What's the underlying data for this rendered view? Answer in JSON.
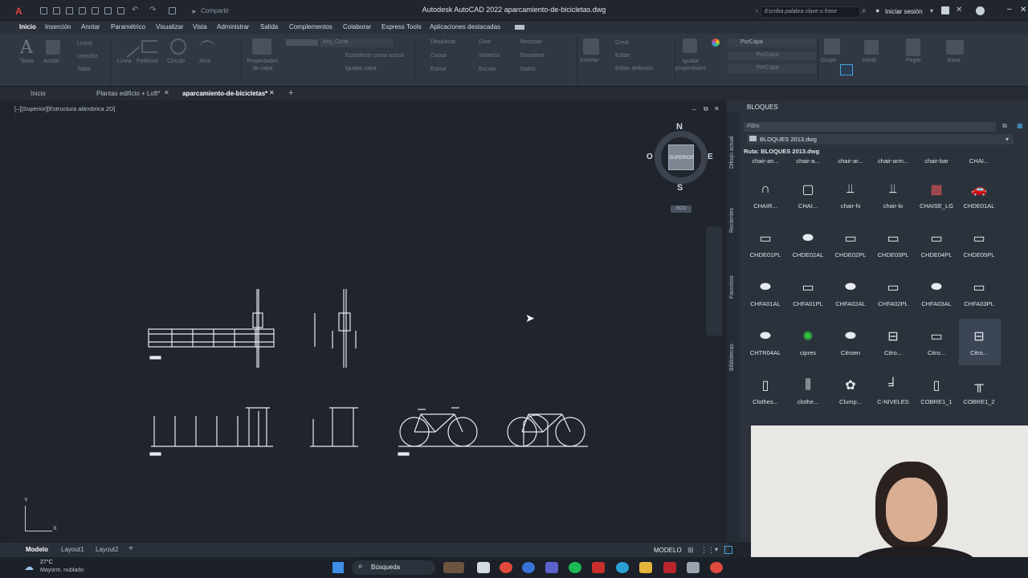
{
  "titlebar": {
    "title": "Autodesk AutoCAD 2022   aparcamiento-de-bicicletas.dwg",
    "share": "Compartir",
    "search_placeholder": "Escriba palabra clave o frase",
    "signin": "Iniciar sesión"
  },
  "menu": [
    "Inicio",
    "Inserción",
    "Anotar",
    "Paramétrico",
    "Visualizar",
    "Vista",
    "Administrar",
    "Salida",
    "Complementos",
    "Colaborar",
    "Express Tools",
    "Aplicaciones destacadas"
  ],
  "ribbon": {
    "draw": [
      "Línea",
      "Polilínea",
      "Círculo",
      "Arco"
    ],
    "modify": [
      "Desplazar",
      "Girar",
      "Recortar",
      "Copiar",
      "Simetría",
      "Empalme",
      "Estirar",
      "Escala",
      "Matriz"
    ],
    "layers": {
      "props": "Propiedades de capa",
      "layer_name": "Arq_Corte",
      "make_current": "Establecer como actual",
      "match": "Igualar capa"
    },
    "annot": {
      "text": "Texto",
      "dim": "Acotar",
      "lineal": "Lineal",
      "directriz": "Directriz",
      "tabla": "Tabla"
    },
    "block": {
      "insert": "Insertar",
      "create": "Crear",
      "edit": "Editar",
      "attrs": "Editar atributos"
    },
    "props": {
      "match": "Igualar propiedades",
      "bylayer": "PorCapa"
    },
    "others": {
      "group": "Grupo",
      "measure": "Medir",
      "paste": "Pegar",
      "base": "Base"
    }
  },
  "doctabs": [
    "Inicio",
    "Plantas edificio + Loft*",
    "aparcamiento-de-bicicletas*"
  ],
  "viewport": {
    "info": "[–][Superior][Estructura alámbrica 2D]",
    "compass": {
      "n": "N",
      "s": "S",
      "e": "E",
      "w": "O",
      "face": "SUPERIOR",
      "wcs": "SCU"
    },
    "ucs_y": "Y",
    "ucs_x": "X"
  },
  "layouts": [
    "Modelo",
    "Layout1",
    "Layout2"
  ],
  "status": {
    "model": "MODELO"
  },
  "palette": {
    "title": "BLOQUES",
    "filter": "Filtro",
    "file": "BLOQUES 2013.dwg",
    "path": "Ruta: BLOQUES 2013.dwg",
    "side_tabs": [
      "Dibujo actual",
      "Recientes",
      "Favoritos",
      "Bibliotecas"
    ],
    "header_row": [
      "chair-an...",
      "chair-a...",
      "chair-ar...",
      "chair-arm...",
      "chair-bar",
      "CHAI..."
    ],
    "rows": [
      [
        {
          "n": "CHAIR...",
          "i": "∩"
        },
        {
          "n": "CHAI...",
          "i": "▢"
        },
        {
          "n": "chair-hi",
          "i": "⫫"
        },
        {
          "n": "chair-lo",
          "i": "⫫"
        },
        {
          "n": "CHAISE_LG",
          "i": "▦"
        },
        {
          "n": "CHDE01AL",
          "i": "🚗"
        }
      ],
      [
        {
          "n": "CHDE01PL",
          "i": "▭"
        },
        {
          "n": "CHDE02AL",
          "i": "⬬"
        },
        {
          "n": "CHDE02PL",
          "i": "▭"
        },
        {
          "n": "CHDE03PL",
          "i": "▭"
        },
        {
          "n": "CHDE04PL",
          "i": "▭"
        },
        {
          "n": "CHDE05PL",
          "i": "▭"
        }
      ],
      [
        {
          "n": "CHFA01AL",
          "i": "⬬"
        },
        {
          "n": "CHFA01PL",
          "i": "▭"
        },
        {
          "n": "CHFA02AL",
          "i": "⬬"
        },
        {
          "n": "CHFA02PL",
          "i": "▭"
        },
        {
          "n": "CHFA03AL",
          "i": "⬬"
        },
        {
          "n": "CHFA03PL",
          "i": "▭"
        }
      ],
      [
        {
          "n": "CHTR04AL",
          "i": "⬬"
        },
        {
          "n": "cipres",
          "i": "✺"
        },
        {
          "n": "Citroen",
          "i": "⬬"
        },
        {
          "n": "Citro...",
          "i": "⊟"
        },
        {
          "n": "Citro...",
          "i": "▭"
        },
        {
          "n": "Citro...",
          "i": "⊟"
        }
      ],
      [
        {
          "n": "Clothes...",
          "i": "▯"
        },
        {
          "n": "clothe...",
          "i": "⫼"
        },
        {
          "n": "Clump...",
          "i": "✿"
        },
        {
          "n": "C-NIVELES",
          "i": "╛"
        },
        {
          "n": "COBRE1_1",
          "i": "▯"
        },
        {
          "n": "COBRE1_2",
          "i": "╥"
        }
      ]
    ]
  },
  "taskbar": {
    "temp": "27°C",
    "weather": "Mayorm. nublado",
    "search": "Búsqueda"
  },
  "colors": {
    "accent": "#4aa3e0",
    "cipres": "#2ecc40",
    "chaise": "#e05555"
  }
}
